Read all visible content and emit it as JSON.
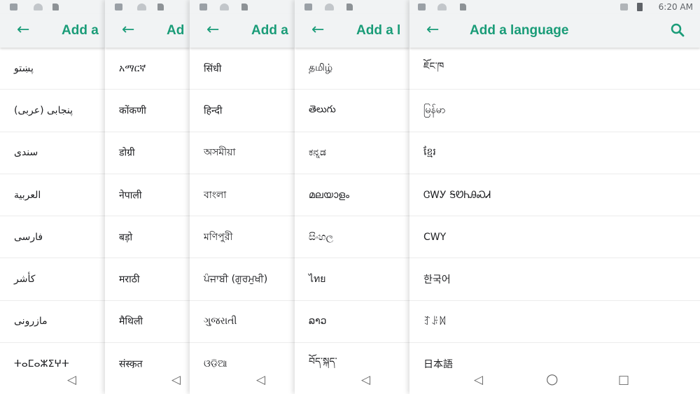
{
  "status_bar": {
    "time": "6:20 AM"
  },
  "app_bar": {
    "back_icon": "arrow-left",
    "title_full": "Add a language",
    "title_truncated": [
      "Add a",
      "Ad",
      "Add a",
      "Add a l"
    ],
    "search_icon": "magnifier"
  },
  "panels": [
    {
      "items": [
        "پښتو",
        "پنجابی (عربی)",
        "سندی",
        "العربية",
        "فارسی",
        "کأشر",
        "مازرونی",
        "ⵜⴰⵎⴰⵣⵉⵖⵜ"
      ]
    },
    {
      "items": [
        "አማርኛ",
        "कोंकणी",
        "डोग्री",
        "नेपाली",
        "बड़ो",
        "मराठी",
        "मैथिली",
        "संस्कृत"
      ]
    },
    {
      "items": [
        "सिंधी",
        "हिन्दी",
        "অসমীয়া",
        "বাংলা",
        "মণিপুরী",
        "ਪੰਜਾਬੀ (ਗੁਰਮੁਖੀ)",
        "ગુજરાતી",
        "ଓଡ଼ିଆ"
      ]
    },
    {
      "items": [
        "தமிழ்",
        "తెలుగు",
        "ಕನ್ನಡ",
        "മലയാളം",
        "සිංහල",
        "ไทย",
        "ລາວ",
        "བོད་སྐད་"
      ]
    },
    {
      "items": [
        "ཇོང་ཁ",
        "မြန်မာ",
        "ខ្មែរ",
        "ᏣᎳᎩ ᎦᏬᏂᎯᏍᏗ",
        "CWY",
        "한국어",
        "ꆈꌠꉙ",
        "日本語"
      ]
    }
  ],
  "nav_bar": {
    "back_glyph": "◁",
    "home_glyph": "○",
    "recents_glyph": "□"
  }
}
